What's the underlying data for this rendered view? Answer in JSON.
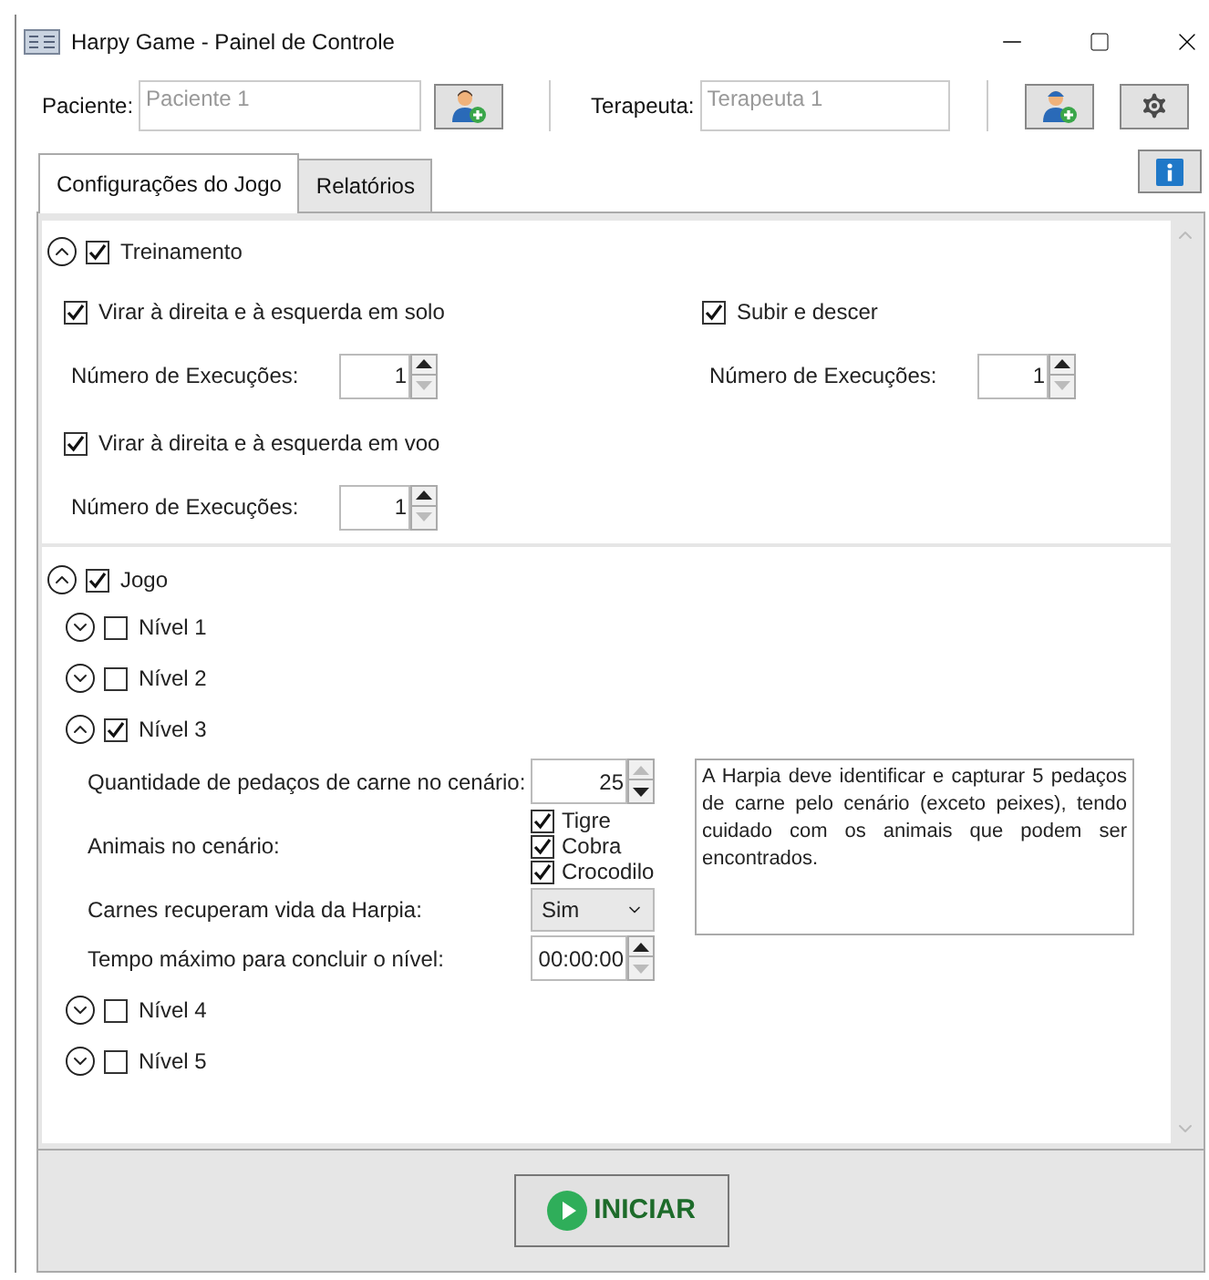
{
  "window": {
    "title": "Harpy Game - Painel de Controle"
  },
  "header": {
    "patient": {
      "label": "Paciente:",
      "placeholder": "Paciente 1"
    },
    "therapist": {
      "label": "Terapeuta:",
      "placeholder": "Terapeuta 1"
    }
  },
  "tabs": [
    {
      "label": "Configurações do Jogo",
      "selected": true
    },
    {
      "label": "Relatórios",
      "selected": false
    }
  ],
  "training": {
    "label": "Treinamento",
    "expanded": true,
    "checked": true,
    "options": [
      {
        "label": "Virar à direita e à esquerda em solo",
        "checked": true,
        "executions": {
          "label": "Número de Execuções:",
          "value": "1",
          "can_increase": true,
          "can_decrease": false
        }
      },
      {
        "label": "Subir e descer",
        "checked": true,
        "executions": {
          "label": "Número de Execuções:",
          "value": "1",
          "can_increase": true,
          "can_decrease": false
        }
      },
      {
        "label": "Virar à direita e à esquerda em voo",
        "checked": true,
        "executions": {
          "label": "Número de Execuções:",
          "value": "1",
          "can_increase": true,
          "can_decrease": false
        }
      }
    ]
  },
  "game": {
    "label": "Jogo",
    "expanded": true,
    "checked": true,
    "levels": [
      {
        "label": "Nível 1",
        "expanded": false,
        "checked": false
      },
      {
        "label": "Nível 2",
        "expanded": false,
        "checked": false
      },
      {
        "label": "Nível 3",
        "expanded": true,
        "checked": true,
        "settings": {
          "meat_count": {
            "label": "Quantidade de pedaços de carne no cenário:",
            "value": "25",
            "can_increase": false,
            "can_decrease": true
          },
          "animals": {
            "label": "Animais no cenário:",
            "options": [
              {
                "label": "Tigre",
                "checked": true
              },
              {
                "label": "Cobra",
                "checked": true
              },
              {
                "label": "Crocodilo",
                "checked": true
              }
            ]
          },
          "meat_restores_life": {
            "label": "Carnes recuperam vida da Harpia:",
            "value": "Sim"
          },
          "max_time": {
            "label": "Tempo máximo para concluir o nível:",
            "value": "00:00:00",
            "can_increase": true,
            "can_decrease": false
          },
          "description": "A Harpia deve identificar e capturar 5 pedaços de carne pelo cenário (exceto peixes), tendo cuidado com os animais que podem ser encontrados."
        }
      },
      {
        "label": "Nível 4",
        "expanded": false,
        "checked": false
      },
      {
        "label": "Nível 5",
        "expanded": false,
        "checked": false
      }
    ]
  },
  "start_button": {
    "label": "INICIAR"
  }
}
